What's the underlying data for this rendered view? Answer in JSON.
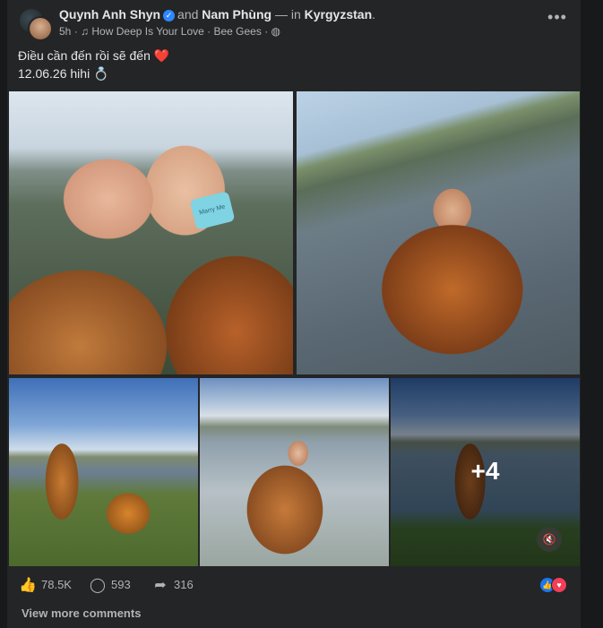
{
  "post": {
    "author": "Quynh Anh Shyn",
    "connector": "and",
    "tagged": "Nam Phùng",
    "location_prefix": "— in",
    "location": "Kyrgyzstan",
    "location_suffix": ".",
    "time": "5h",
    "music": "How Deep Is Your Love · Bee Gees",
    "privacy_icon": "globe-icon",
    "caption_line1": "Điều cần đến rồi sẽ đến",
    "caption_emoji": "❤️",
    "caption_line2": "12.06.26 hihi",
    "caption_emoji2": "💍",
    "more_photos": "+4",
    "ring_box_text": "Marry Me"
  },
  "stats": {
    "likes": "78.5K",
    "comments": "593",
    "shares": "316"
  },
  "reactions": [
    "like-icon",
    "love-icon"
  ],
  "view_more": "View more comments",
  "colors": {
    "background": "#18191a",
    "card": "#242526",
    "text": "#e4e6eb",
    "muted": "#b0b3b8",
    "link_blue": "#1877f2",
    "love": "#f33e58"
  }
}
